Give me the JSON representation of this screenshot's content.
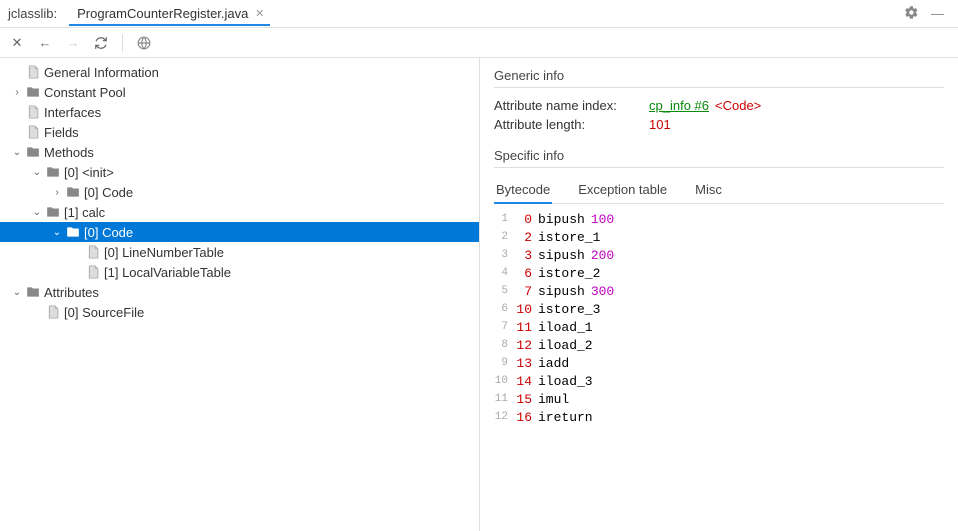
{
  "titlebar": {
    "app_name": "jclasslib:",
    "tab_label": "ProgramCounterRegister.java"
  },
  "tree": [
    {
      "depth": 0,
      "chev": "",
      "icon": "file",
      "label": "General Information",
      "sel": false
    },
    {
      "depth": 0,
      "chev": ">",
      "icon": "folder",
      "label": "Constant Pool",
      "sel": false
    },
    {
      "depth": 0,
      "chev": "",
      "icon": "file",
      "label": "Interfaces",
      "sel": false
    },
    {
      "depth": 0,
      "chev": "",
      "icon": "file",
      "label": "Fields",
      "sel": false
    },
    {
      "depth": 0,
      "chev": "v",
      "icon": "folder",
      "label": "Methods",
      "sel": false
    },
    {
      "depth": 1,
      "chev": "v",
      "icon": "folder",
      "label": "[0] <init>",
      "sel": false
    },
    {
      "depth": 2,
      "chev": ">",
      "icon": "folder",
      "label": "[0] Code",
      "sel": false
    },
    {
      "depth": 1,
      "chev": "v",
      "icon": "folder",
      "label": "[1] calc",
      "sel": false
    },
    {
      "depth": 2,
      "chev": "v",
      "icon": "folder",
      "label": "[0] Code",
      "sel": true
    },
    {
      "depth": 3,
      "chev": "",
      "icon": "file",
      "label": "[0] LineNumberTable",
      "sel": false
    },
    {
      "depth": 3,
      "chev": "",
      "icon": "file",
      "label": "[1] LocalVariableTable",
      "sel": false
    },
    {
      "depth": 0,
      "chev": "v",
      "icon": "folder",
      "label": "Attributes",
      "sel": false
    },
    {
      "depth": 1,
      "chev": "",
      "icon": "file",
      "label": "[0] SourceFile",
      "sel": false
    }
  ],
  "detail": {
    "generic_title": "Generic info",
    "attr_name_label": "Attribute name index:",
    "attr_name_link": "cp_info #6",
    "attr_name_tag": "<Code>",
    "attr_len_label": "Attribute length:",
    "attr_len_value": "101",
    "specific_title": "Specific info",
    "tabs": [
      "Bytecode",
      "Exception table",
      "Misc"
    ],
    "active_tab": 0,
    "bytecode": [
      {
        "ln": "1",
        "pc": "0",
        "op": "bipush",
        "arg": "100"
      },
      {
        "ln": "2",
        "pc": "2",
        "op": "istore_1",
        "arg": ""
      },
      {
        "ln": "3",
        "pc": "3",
        "op": "sipush",
        "arg": "200"
      },
      {
        "ln": "4",
        "pc": "6",
        "op": "istore_2",
        "arg": ""
      },
      {
        "ln": "5",
        "pc": "7",
        "op": "sipush",
        "arg": "300"
      },
      {
        "ln": "6",
        "pc": "10",
        "op": "istore_3",
        "arg": ""
      },
      {
        "ln": "7",
        "pc": "11",
        "op": "iload_1",
        "arg": ""
      },
      {
        "ln": "8",
        "pc": "12",
        "op": "iload_2",
        "arg": ""
      },
      {
        "ln": "9",
        "pc": "13",
        "op": "iadd",
        "arg": ""
      },
      {
        "ln": "10",
        "pc": "14",
        "op": "iload_3",
        "arg": ""
      },
      {
        "ln": "11",
        "pc": "15",
        "op": "imul",
        "arg": ""
      },
      {
        "ln": "12",
        "pc": "16",
        "op": "ireturn",
        "arg": ""
      }
    ]
  }
}
